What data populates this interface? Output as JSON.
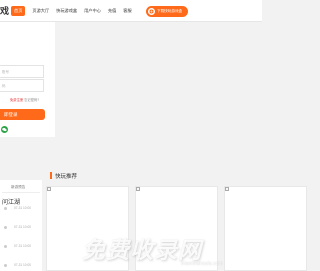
{
  "header": {
    "brand": "戏",
    "nav": [
      {
        "label": "首页",
        "active": true
      },
      {
        "label": "页游大厅",
        "active": false
      },
      {
        "label": "快玩游戏盒",
        "active": false
      },
      {
        "label": "用户中心",
        "active": false
      },
      {
        "label": "充值",
        "active": false
      },
      {
        "label": "客服",
        "active": false
      }
    ],
    "download_label": "下载快玩游戏盒"
  },
  "login": {
    "username_placeholder": "账号",
    "password_placeholder": "码",
    "register_link": "免费注册",
    "forgot_link": "忘记密码?",
    "login_button": "即登录",
    "wechat_icon": "wechat-icon"
  },
  "list": {
    "title": "新游预告",
    "headline": "问江湖",
    "rows": [
      "07-31 10:00",
      "07-31 10:00",
      "07-31 10:00",
      "07-31 10:00"
    ]
  },
  "recommend": {
    "title": "快玩推荐",
    "cards": 3
  },
  "watermark": {
    "text": "免费收录网",
    "domain": "mianfeishoulu.com"
  },
  "colors": {
    "accent": "#ff6a1a",
    "link_red": "#ee3333",
    "wechat": "#2ba245"
  }
}
